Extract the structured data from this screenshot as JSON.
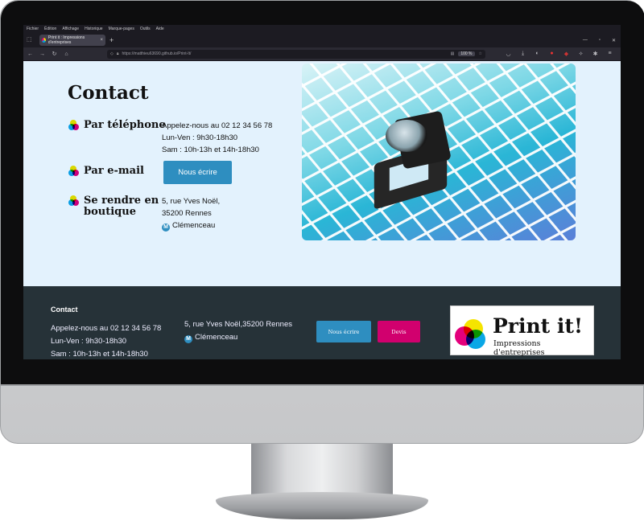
{
  "browser": {
    "menu": [
      "Fichier",
      "Édition",
      "Affichage",
      "Historique",
      "Marque-pages",
      "Outils",
      "Aide"
    ],
    "tab_title": "Print it : Impressions d'entreprises",
    "tab_close": "×",
    "new_tab": "+",
    "url": "https://matthieu63690.github.io/Print-It/",
    "zoom": "100 %"
  },
  "page": {
    "title": "Contact",
    "phone": {
      "label": "Par téléphone",
      "lines": [
        "Appelez-nous au 02 12 34 56 78",
        "Lun-Ven : 9h30-18h30",
        "Sam : 10h-13h et 14h-18h30"
      ]
    },
    "email": {
      "label": "Par e-mail",
      "button": "Nous écrire"
    },
    "shop": {
      "label_line1": "Se rendre en",
      "label_line2": "boutique",
      "address1": "5, rue Yves Noël,",
      "address2": "35200 Rennes",
      "metro_letter": "M",
      "metro_station": "Clémenceau"
    }
  },
  "footer": {
    "title": "Contact",
    "lines": [
      "Appelez-nous au 02 12 34 56 78",
      "Lun-Ven : 9h30-18h30",
      "Sam : 10h-13h et 14h-18h30"
    ],
    "address": "5, rue Yves Noël,35200 Rennes",
    "metro_letter": "M",
    "metro_station": "Clémenceau",
    "button_write": "Nous écrire",
    "button_quote": "Devis",
    "logo_name": "Print it!",
    "logo_sub": "Impressions d'entreprises"
  },
  "colors": {
    "page_bg": "#e3f2fd",
    "footer_bg": "#263238",
    "button_blue": "#2e8ec0",
    "button_magenta": "#d1006e",
    "brand_yellow": "#f5e400",
    "brand_cyan": "#0aa7e6",
    "brand_magenta": "#e4007c"
  }
}
